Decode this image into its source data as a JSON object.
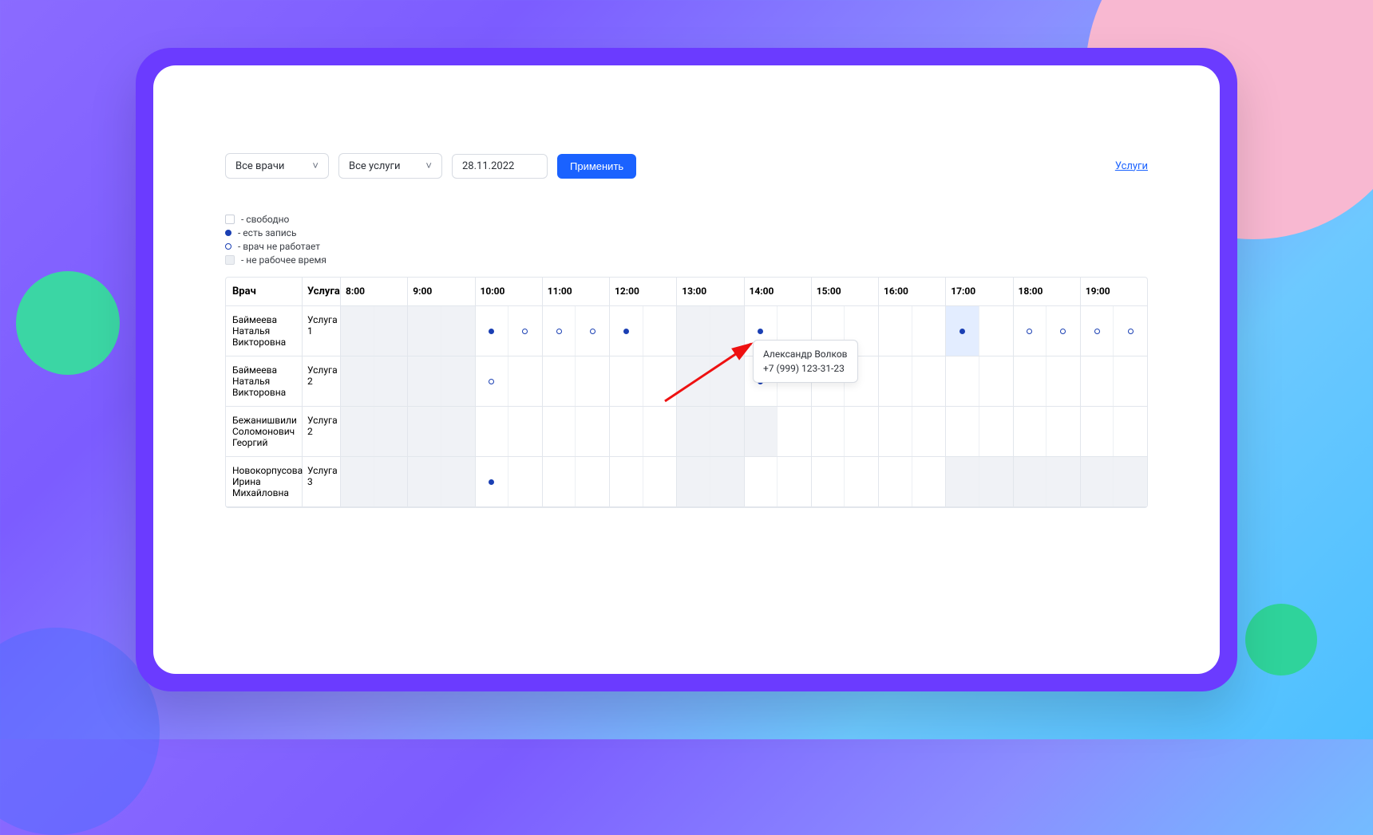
{
  "toolbar": {
    "doctor_select": "Все врачи",
    "service_select": "Все услуги",
    "date_value": "28.11.2022",
    "apply_label": "Применить",
    "services_link": "Услуги"
  },
  "legend": {
    "free": "- свободно",
    "booked": "- есть запись",
    "not_working": "- врач не работает",
    "non_work_hours": "- не рабочее время"
  },
  "table": {
    "doctor_header": "Врач",
    "service_header": "Услуга",
    "hours": [
      "8:00",
      "9:00",
      "10:00",
      "11:00",
      "12:00",
      "13:00",
      "14:00",
      "15:00",
      "16:00",
      "17:00",
      "18:00",
      "19:00"
    ],
    "rows": [
      {
        "doctor": "Баймеева Наталья Викторовна",
        "service": "Услуга 1",
        "slots": {
          "8:00": [
            "nonwork",
            "nonwork"
          ],
          "9:00": [
            "nonwork",
            "nonwork"
          ],
          "10:00": [
            "filled",
            "hollow"
          ],
          "11:00": [
            "hollow",
            "hollow"
          ],
          "12:00": [
            "filled",
            ""
          ],
          "13:00": [
            "nonwork",
            "nonwork"
          ],
          "14:00": [
            "filled",
            ""
          ],
          "15:00": [
            "",
            ""
          ],
          "16:00": [
            "",
            ""
          ],
          "17:00": [
            "filled-hl",
            ""
          ],
          "18:00": [
            "hollow",
            "hollow"
          ],
          "19:00": [
            "hollow",
            "hollow"
          ]
        }
      },
      {
        "doctor": "Баймеева Наталья Викторовна",
        "service": "Услуга 2",
        "slots": {
          "8:00": [
            "nonwork",
            "nonwork"
          ],
          "9:00": [
            "nonwork",
            "nonwork"
          ],
          "10:00": [
            "hollow",
            ""
          ],
          "11:00": [
            "",
            ""
          ],
          "12:00": [
            "",
            ""
          ],
          "13:00": [
            "nonwork",
            "nonwork"
          ],
          "14:00": [
            "filled",
            ""
          ],
          "15:00": [
            "",
            ""
          ],
          "16:00": [
            "",
            ""
          ],
          "17:00": [
            "",
            ""
          ],
          "18:00": [
            "",
            ""
          ],
          "19:00": [
            "",
            ""
          ]
        }
      },
      {
        "doctor": "Бежанишвили Соломонович Георгий",
        "service": "Услуга 2",
        "slots": {
          "8:00": [
            "nonwork",
            "nonwork"
          ],
          "9:00": [
            "nonwork",
            "nonwork"
          ],
          "10:00": [
            "",
            ""
          ],
          "11:00": [
            "",
            ""
          ],
          "12:00": [
            "",
            ""
          ],
          "13:00": [
            "nonwork",
            "nonwork"
          ],
          "14:00": [
            "nonwork",
            ""
          ],
          "15:00": [
            "",
            ""
          ],
          "16:00": [
            "",
            ""
          ],
          "17:00": [
            "",
            ""
          ],
          "18:00": [
            "",
            ""
          ],
          "19:00": [
            "",
            ""
          ]
        }
      },
      {
        "doctor": "Новокорпусова Ирина Михайловна",
        "service": "Услуга 3",
        "slots": {
          "8:00": [
            "nonwork",
            "nonwork"
          ],
          "9:00": [
            "nonwork",
            "nonwork"
          ],
          "10:00": [
            "filled",
            ""
          ],
          "11:00": [
            "",
            ""
          ],
          "12:00": [
            "",
            ""
          ],
          "13:00": [
            "nonwork",
            "nonwork"
          ],
          "14:00": [
            "",
            ""
          ],
          "15:00": [
            "",
            ""
          ],
          "16:00": [
            "",
            ""
          ],
          "17:00": [
            "nonwork",
            "nonwork"
          ],
          "18:00": [
            "nonwork",
            "nonwork"
          ],
          "19:00": [
            "nonwork",
            "nonwork"
          ]
        }
      }
    ]
  },
  "tooltip": {
    "name": "Александр Волков",
    "phone": "+7 (999) 123-31-23"
  }
}
